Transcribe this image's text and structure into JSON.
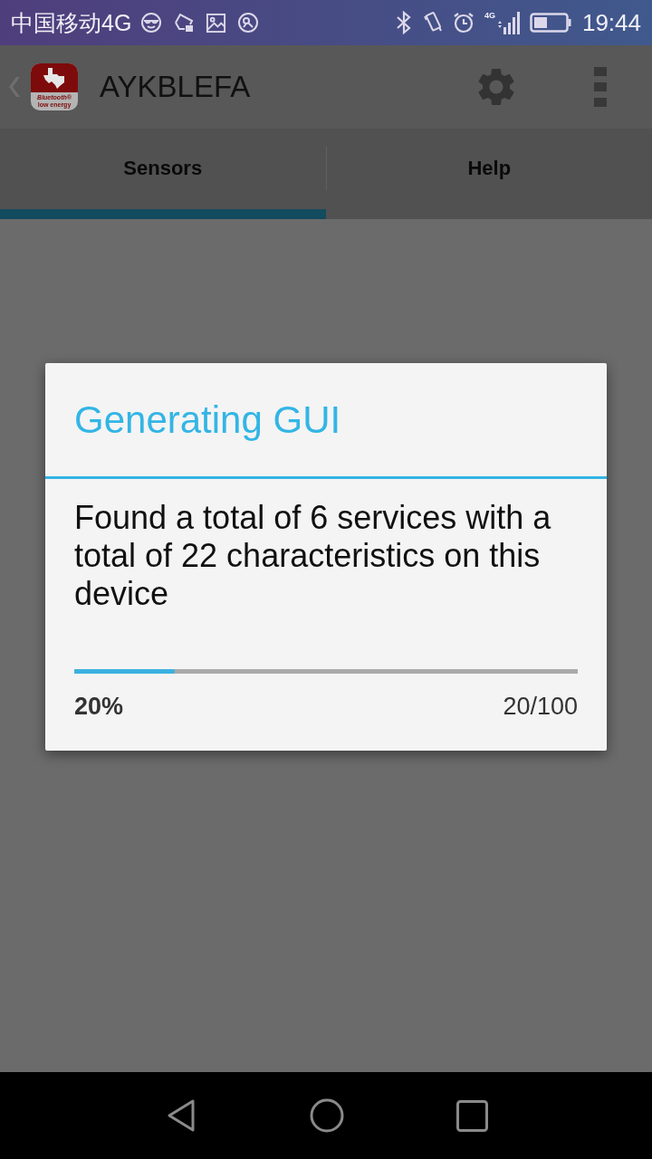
{
  "status_bar": {
    "carrier": "中国移动4G",
    "network_type": "4G",
    "time": "19:44"
  },
  "app_bar": {
    "logo": {
      "lines": [
        "Bluetooth®",
        "low energy"
      ]
    },
    "title": "AYKBLEFA"
  },
  "tabs": [
    {
      "label": "Sensors",
      "selected": true
    },
    {
      "label": "Help",
      "selected": false
    }
  ],
  "dialog": {
    "title": "Generating GUI",
    "message": "Found a total of 6 services with a total of 22 characteristics on this device",
    "progress": {
      "level": 0.2,
      "percent": "20%",
      "count": "20/100"
    }
  }
}
